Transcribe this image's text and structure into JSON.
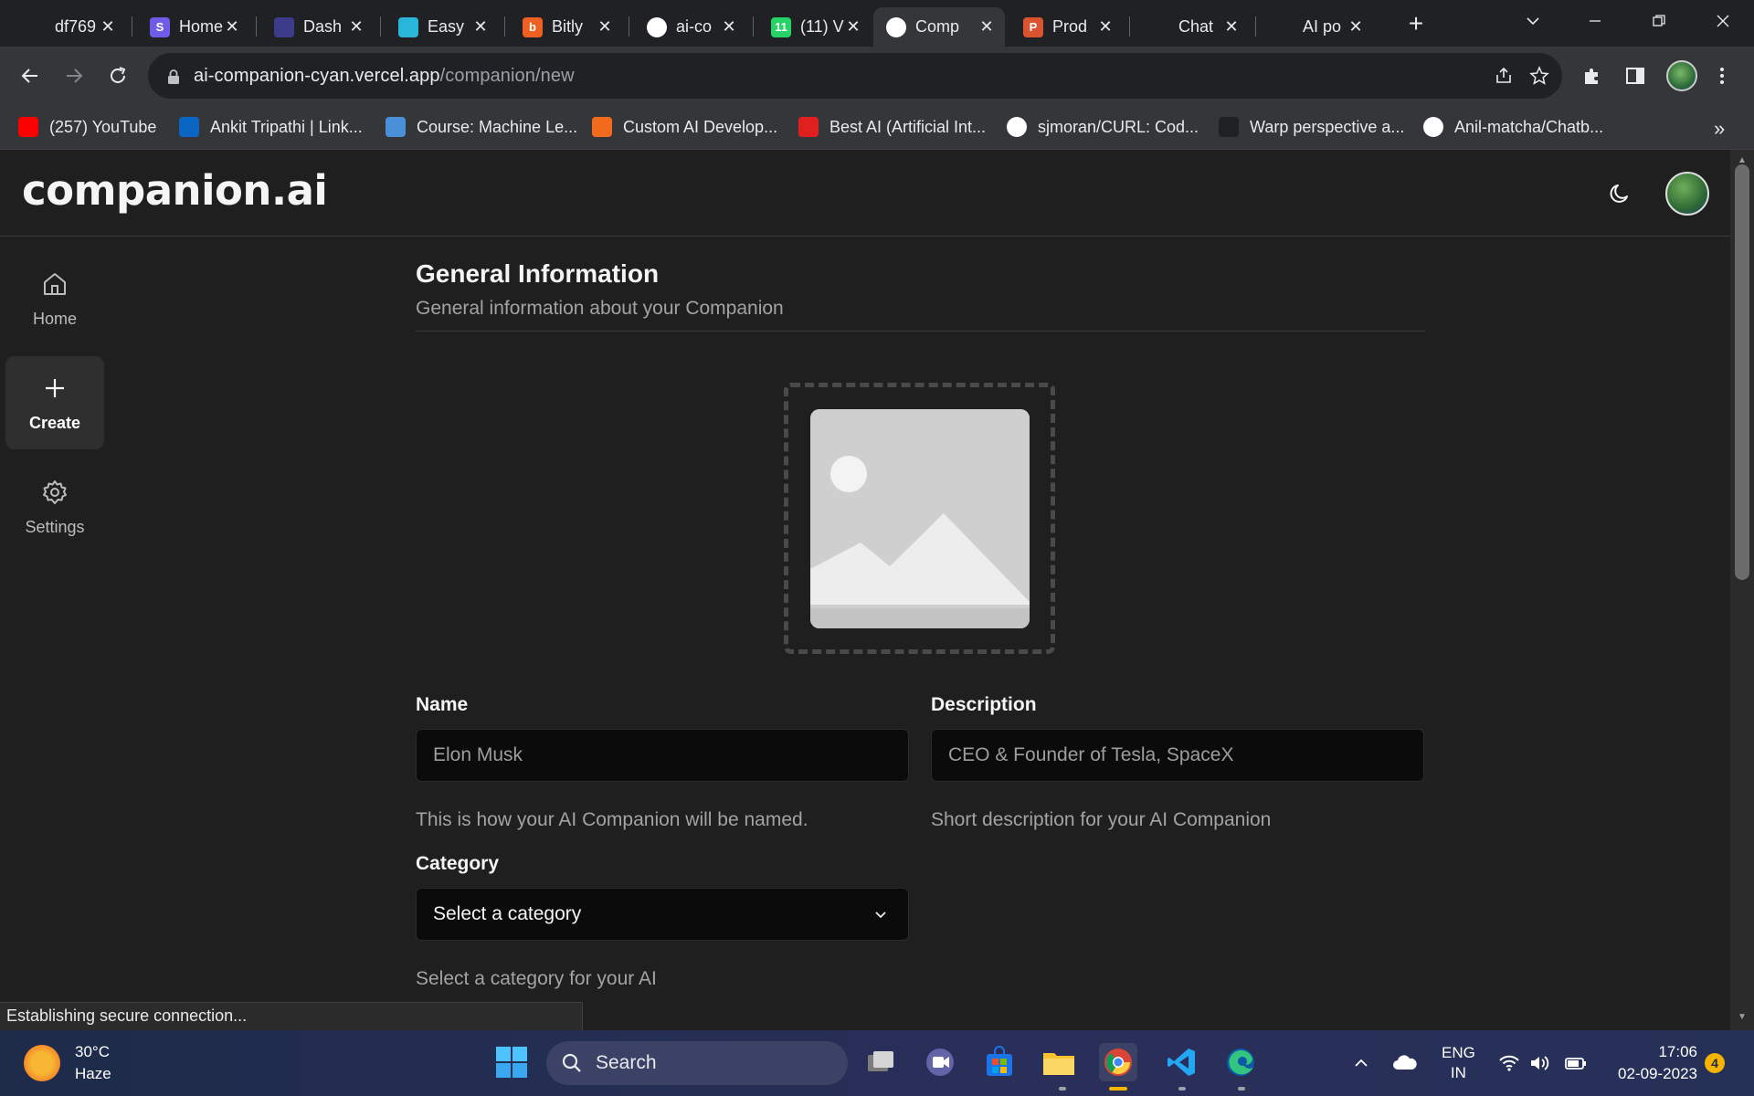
{
  "browser": {
    "tabs": [
      {
        "title": "df769",
        "favicon_text": "",
        "favicon_color": "#202124"
      },
      {
        "title": "Home",
        "favicon_text": "S",
        "favicon_color": "#6c5ce7"
      },
      {
        "title": "Dash",
        "favicon_text": "",
        "favicon_color": "#3c3c8a"
      },
      {
        "title": "Easy",
        "favicon_text": "",
        "favicon_color": "#29b6d8"
      },
      {
        "title": "Bitly",
        "favicon_text": "b",
        "favicon_color": "#ee6123"
      },
      {
        "title": "ai-co",
        "favicon_text": "",
        "favicon_color": "#ffffff"
      },
      {
        "title": "(11) V",
        "favicon_text": "11",
        "favicon_color": "#25d366"
      },
      {
        "title": "Comp",
        "favicon_text": "",
        "favicon_color": "#ffffff"
      },
      {
        "title": "Prod",
        "favicon_text": "P",
        "favicon_color": "#da552f"
      },
      {
        "title": "Chat",
        "favicon_text": "",
        "favicon_color": "#202124"
      },
      {
        "title": "AI po",
        "favicon_text": "",
        "favicon_color": "#202124"
      }
    ],
    "active_tab_index": 7,
    "url_host": "ai-companion-cyan.vercel.app",
    "url_path": "/companion/new",
    "bookmarks": [
      {
        "label": "(257) YouTube",
        "icon_color": "#ff0000"
      },
      {
        "label": "Ankit Tripathi | Link...",
        "icon_color": "#0a66c2"
      },
      {
        "label": "Course: Machine Le...",
        "icon_color": "#4a90d9"
      },
      {
        "label": "Custom AI Develop...",
        "icon_color": "#f26b1d"
      },
      {
        "label": "Best AI (Artificial Int...",
        "icon_color": "#e0201f"
      },
      {
        "label": "sjmoran/CURL: Cod...",
        "icon_color": "#ffffff"
      },
      {
        "label": "Warp perspective a...",
        "icon_color": "#202124"
      },
      {
        "label": "Anil-matcha/Chatb...",
        "icon_color": "#ffffff"
      }
    ],
    "status_text": "Establishing secure connection..."
  },
  "app": {
    "logo": "companion.ai",
    "sidebar": [
      {
        "label": "Home",
        "icon": "home-icon",
        "active": false
      },
      {
        "label": "Create",
        "icon": "plus-icon",
        "active": true
      },
      {
        "label": "Settings",
        "icon": "gear-icon",
        "active": false
      }
    ],
    "form": {
      "title": "General Information",
      "subtitle": "General information about your Companion",
      "name_label": "Name",
      "name_placeholder": "Elon Musk",
      "name_hint": "This is how your AI Companion will be named.",
      "description_label": "Description",
      "description_placeholder": "CEO & Founder of Tesla, SpaceX",
      "description_hint": "Short description for your AI Companion",
      "category_label": "Category",
      "category_value": "Select a category",
      "category_hint": "Select a category for your AI"
    }
  },
  "taskbar": {
    "temperature": "30°C",
    "weather": "Haze",
    "search_placeholder": "Search",
    "language": "ENG",
    "region": "IN",
    "time": "17:06",
    "date": "02-09-2023",
    "notification_count": "4"
  }
}
